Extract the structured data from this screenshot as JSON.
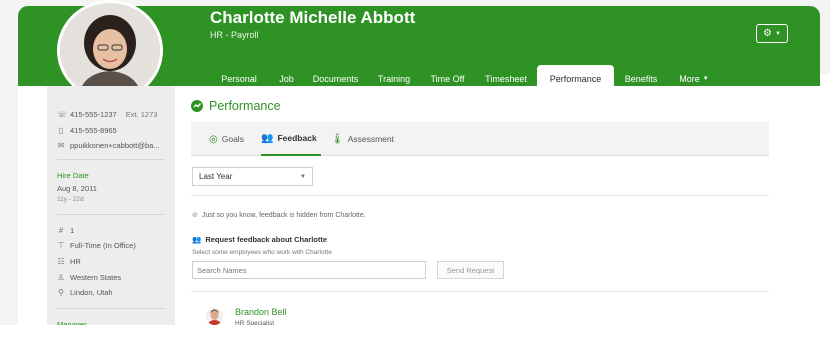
{
  "header": {
    "name": "Charlotte Michelle Abbott",
    "role": "HR - Payroll",
    "settings_icon": "gear-icon",
    "brand_color": "#2f9225"
  },
  "tabs": [
    {
      "label": "Personal",
      "active": false
    },
    {
      "label": "Job",
      "active": false
    },
    {
      "label": "Documents",
      "active": false
    },
    {
      "label": "Training",
      "active": false
    },
    {
      "label": "Time Off",
      "active": false
    },
    {
      "label": "Timesheet",
      "active": false
    },
    {
      "label": "Performance",
      "active": true
    },
    {
      "label": "Benefits",
      "active": false
    },
    {
      "label": "More",
      "active": false
    }
  ],
  "sidebar": {
    "work_phone": "415-555-1237",
    "work_ext": "Ext. 1273",
    "mobile_phone": "415-555-8965",
    "email": "ppuikkonen+cabbott@ba...",
    "hire_date_label": "Hire Date",
    "hire_date": "Aug 8, 2011",
    "tenure": "11y - 22d",
    "employee_number": "1",
    "employment_status": "Full-Time (In Office)",
    "department": "HR",
    "division": "Western States",
    "location": "Lindon, Utah",
    "manager_label": "Manager"
  },
  "performance": {
    "title": "Performance",
    "subtabs": [
      {
        "label": "Goals",
        "icon": "target-icon",
        "active": false
      },
      {
        "label": "Feedback",
        "icon": "people-icon",
        "active": true
      },
      {
        "label": "Assessment",
        "icon": "thermometer-icon",
        "active": false
      }
    ],
    "period_select": "Last Year",
    "hidden_notice": "Just so you know, feedback is hidden from Charlotte.",
    "request_title": "Request feedback about Charlotte",
    "request_subtitle": "Select some employees who work with Charlotte",
    "search_placeholder": "Search Names",
    "send_button": "Send Request"
  },
  "feedback_list": [
    {
      "name": "Brandon Bell",
      "role": "HR Specialist"
    }
  ]
}
